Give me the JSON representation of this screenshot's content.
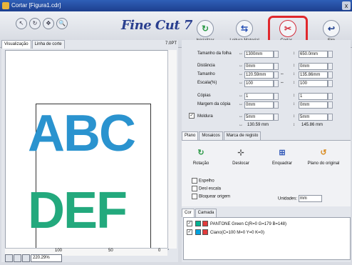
{
  "window": {
    "title": "Cortar [Figura1.cdr]",
    "close_label": "x"
  },
  "toolbar": {
    "tools": [
      {
        "name": "pointer-tool",
        "glyph": "↖"
      },
      {
        "name": "rotate-tool",
        "glyph": "↻"
      },
      {
        "name": "pan-tool",
        "glyph": "✥"
      },
      {
        "name": "zoom-tool",
        "glyph": "🔍"
      }
    ],
    "logo": "Fine Cut 7",
    "buttons": [
      {
        "name": "initialize-button",
        "label": "Inicializar",
        "glyph": "↻",
        "color": "#2d9a48"
      },
      {
        "name": "read-material-button",
        "label": "Leitura Material",
        "glyph": "⇆",
        "color": "#2f57b8"
      },
      {
        "name": "cut-button",
        "label": "Cortar...",
        "glyph": "✂",
        "color": "#d32d3b"
      },
      {
        "name": "end-button",
        "label": "Fim",
        "glyph": "↩",
        "color": "#1f3f8e"
      }
    ]
  },
  "left": {
    "tabs": [
      "Visualização",
      "Linha de corte"
    ],
    "scale": "7.0PT",
    "preview": {
      "top_text": "ABC",
      "bottom_text": "DEF",
      "top_color": "#2a93cf",
      "bottom_color": "#23a97d"
    },
    "ruler": [
      "100",
      "50",
      "0"
    ],
    "zoom": "220.29%"
  },
  "right": {
    "folha": {
      "label": "Tamanho da folha",
      "sym": "↔",
      "v1": "1300mm",
      "sym2": "↕",
      "v2": "650.0mm"
    },
    "rows1": [
      {
        "label": "Distância",
        "sym": "↔",
        "v1": "0mm",
        "mid": "",
        "sym2": "↕",
        "v2": "0mm"
      },
      {
        "label": "Tamanho",
        "sym": "↔",
        "v1": "120.59mm",
        "mid": "⇔",
        "sym2": "↕",
        "v2": "135.86mm"
      },
      {
        "label": "Escala(%)",
        "sym": "↔",
        "v1": "100",
        "mid": "⇔",
        "sym2": "↕",
        "v2": "100"
      }
    ],
    "rows2": [
      {
        "label": "Cópias",
        "sym": "↔",
        "v1": "1",
        "mid": "",
        "sym2": "↕",
        "v2": "1"
      },
      {
        "label": "Margem da cópia",
        "sym": "↔",
        "v1": "0mm",
        "mid": "",
        "sym2": "↕",
        "v2": "0mm"
      }
    ],
    "moldura": {
      "label": "Moldura",
      "sym": "↔",
      "v1": "5mm",
      "sym2": "↕",
      "v2": "5mm"
    },
    "summary": {
      "sym": "↔",
      "v1": "130.59 mm",
      "sym2": "↕",
      "v2": "145.86 mm"
    },
    "tabs": [
      "Plano",
      "Mosaicos",
      "Marca de registo"
    ],
    "plano_buttons": [
      {
        "name": "rotation-button",
        "label": "Rotação",
        "glyph": "↻",
        "color": "#2d9a48"
      },
      {
        "name": "move-button",
        "label": "Deslocar",
        "glyph": "⊹",
        "color": "#444"
      },
      {
        "name": "align-button",
        "label": "Enquadrar",
        "glyph": "⊞",
        "color": "#2f57b8"
      },
      {
        "name": "original-position-button",
        "label": "Plano do original",
        "glyph": "↺",
        "color": "#d98c22"
      }
    ],
    "options": [
      "Espelho",
      "Desl escala",
      "Bloquear origem"
    ],
    "units_label": "Unidades:",
    "units_value": "mm",
    "color_tabs": [
      "Cor",
      "Camada"
    ],
    "colors": [
      {
        "label": "PANTONE Green C(R=0 G=179 B=148)",
        "color": "#00b394"
      },
      {
        "label": "Ciano(C=100 M=0 Y=0 K=0)",
        "color": "#00a3e0"
      }
    ]
  }
}
